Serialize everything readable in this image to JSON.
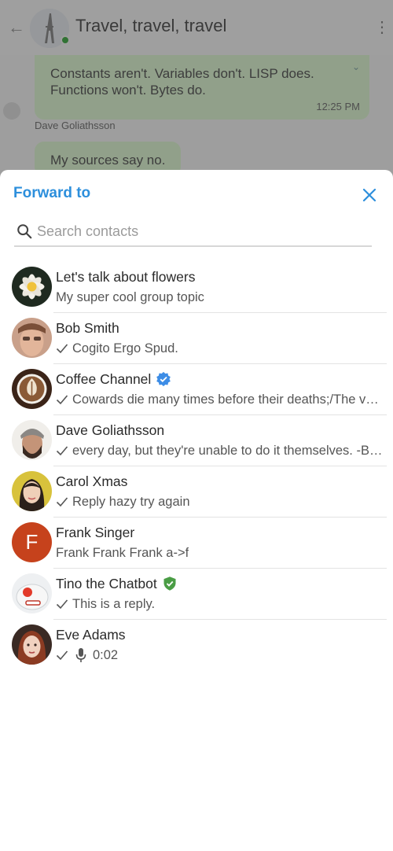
{
  "background_chat": {
    "title": "Travel, travel, travel",
    "message1": "Constants aren't. Variables don't. LISP does. Functions won't. Bytes do.",
    "message1_time": "12:25 PM",
    "sender": "Dave Goliathsson",
    "message2": "My sources say no."
  },
  "sheet": {
    "title": "Forward to",
    "search_placeholder": "Search contacts"
  },
  "contacts": [
    {
      "name": "Let's talk about flowers",
      "subtitle": "My super cool group topic",
      "avatar": "flower-avatar"
    },
    {
      "name": "Bob Smith",
      "subtitle": "Cogito Ergo Spud.",
      "avatar": "person-avatar"
    },
    {
      "name": "Coffee Channel",
      "subtitle": "Cowards die many times before their deaths;/The valiant never taste of death but once.",
      "avatar": "coffee-avatar",
      "badge": "verified-blue"
    },
    {
      "name": "Dave Goliathsson",
      "subtitle": "every day, but they're unable to do it themselves. -Bruce Lee",
      "avatar": "person-avatar"
    },
    {
      "name": "Carol Xmas",
      "subtitle": "Reply hazy try again",
      "avatar": "person-avatar"
    },
    {
      "name": "Frank Singer",
      "subtitle": "Frank Frank Frank a->f",
      "avatar_letter": "F",
      "avatar_color": "#c6421c"
    },
    {
      "name": "Tino the Chatbot",
      "subtitle": "This is a reply.",
      "avatar": "robot-avatar",
      "badge": "verified-green"
    },
    {
      "name": "Eve Adams",
      "subtitle": "0:02",
      "avatar": "person-avatar",
      "attachment_icon": "mic-icon"
    }
  ],
  "colors": {
    "accent": "#2d8fdc",
    "verified_blue": "#3d8de6",
    "verified_green": "#4a9d45"
  }
}
